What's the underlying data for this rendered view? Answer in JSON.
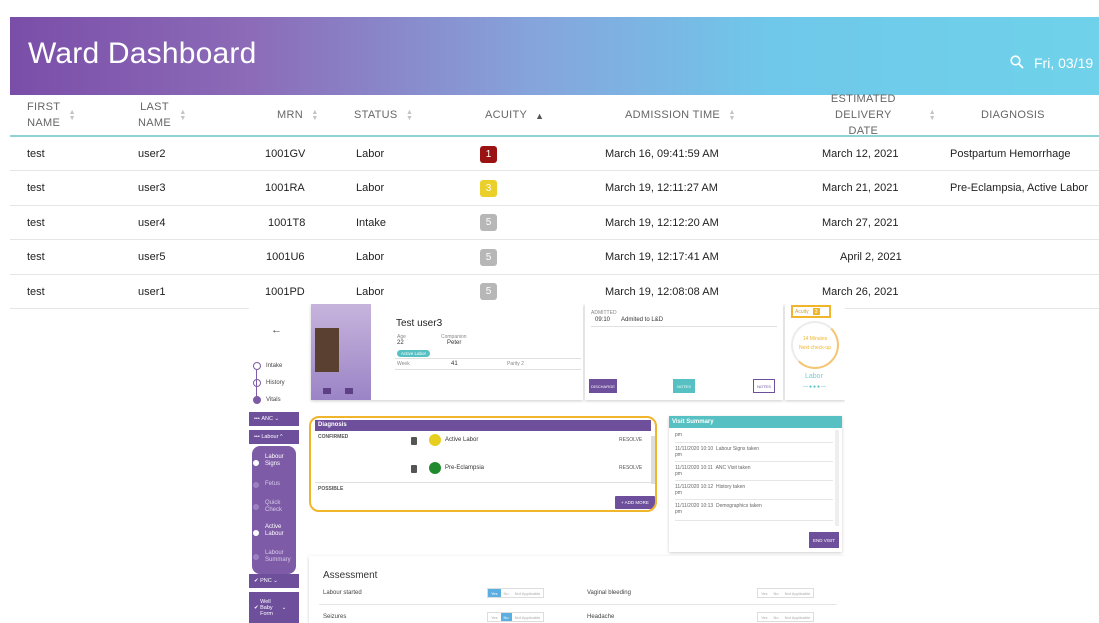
{
  "header": {
    "title": "Ward Dashboard",
    "date": "Fri, 03/19",
    "search_icon": "search-icon",
    "colors": {
      "gradient_start": "#7a4ea8",
      "gradient_end": "#6fd2ea"
    }
  },
  "table": {
    "columns": [
      {
        "line1": "FIRST",
        "line2": "NAME"
      },
      {
        "line1": "LAST",
        "line2": "NAME"
      },
      {
        "line1": "MRN",
        "line2": ""
      },
      {
        "line1": "STATUS",
        "line2": ""
      },
      {
        "line1": "ACUITY",
        "line2": ""
      },
      {
        "line1": "ADMISSION TIME",
        "line2": ""
      },
      {
        "line1": "ESTIMATED DELIVERY",
        "line2": "DATE"
      },
      {
        "line1": "DIAGNOSIS",
        "line2": ""
      }
    ],
    "sorted_column": "ACUITY",
    "rows": [
      {
        "first": "test",
        "last": "user2",
        "mrn": "1001GV",
        "status": "Labor",
        "acuity": "1",
        "acuity_color": "#9b1212",
        "admission": "March 16, 09:41:59 AM",
        "edd": "March 12, 2021",
        "diagnosis": "Postpartum Hemorrhage"
      },
      {
        "first": "test",
        "last": "user3",
        "mrn": "1001RA",
        "status": "Labor",
        "acuity": "3",
        "acuity_color": "#ebcf2a",
        "admission": "March 19, 12:11:27 AM",
        "edd": "March 21, 2021",
        "diagnosis": "Pre-Eclampsia, Active Labor"
      },
      {
        "first": "test",
        "last": "user4",
        "mrn": "1001T8",
        "status": "Intake",
        "acuity": "5",
        "acuity_color": "#b7b7b7",
        "admission": "March 19, 12:12:20 AM",
        "edd": "March 27, 2021",
        "diagnosis": ""
      },
      {
        "first": "test",
        "last": "user5",
        "mrn": "1001U6",
        "status": "Labor",
        "acuity": "5",
        "acuity_color": "#b7b7b7",
        "admission": "March 19, 12:17:41 AM",
        "edd": "April 2, 2021",
        "diagnosis": ""
      },
      {
        "first": "test",
        "last": "user1",
        "mrn": "1001PD",
        "status": "Labor",
        "acuity": "5",
        "acuity_color": "#b7b7b7",
        "admission": "March 19, 12:08:08 AM",
        "edd": "March 26, 2021",
        "diagnosis": ""
      }
    ]
  },
  "patient": {
    "back_icon": "arrow-left-icon",
    "sidebar": {
      "steps": [
        "Intake",
        "History",
        "Vitals"
      ],
      "anc": "ANC",
      "labour": "Labour",
      "labour_subs": [
        "Labour Signs",
        "Fetus",
        "Quick Check",
        "Active Labour",
        "Labour Summary"
      ],
      "pnc": "PNC",
      "wellbaby": "Well Baby Form"
    },
    "name": "Test user3",
    "age_label": "Age",
    "age": "22",
    "companion_label": "Companion",
    "companion": "Peter",
    "badge": "Active Labor",
    "week_label": "Week",
    "week": "41",
    "parity": "Parity 2",
    "admitted_label": "ADMITTED",
    "admitted_time": "09:10",
    "admitted_text": "Admited to L&D",
    "buttons": {
      "discharge": "DISCHARGE",
      "notes_teal": "NOTES",
      "notes": "NOTES"
    },
    "acuity_label": "Acuity",
    "acuity_value": "3",
    "timer_minutes": "14 Minutes",
    "timer_label": "Next check-up",
    "labor_label": "Labor"
  },
  "diagnosis": {
    "title": "Diagnosis",
    "confirmed_label": "CONFIRMED",
    "possible_label": "POSSIBLE",
    "resolve_label": "RESOLVE",
    "add_more": "+ ADD MORE",
    "items": [
      {
        "name": "Active Labor",
        "color": "#e8cf1f"
      },
      {
        "name": "Pre-Eclampsia",
        "color": "#1f8a2e"
      }
    ]
  },
  "visit_summary": {
    "title": "Visit Summary",
    "entries": [
      {
        "time": "pm",
        "text": ""
      },
      {
        "time": "11/11/2020 10:10",
        "text": "Labour Signs taken",
        "suffix": "pm"
      },
      {
        "time": "11/11/2020 10:11",
        "text": "ANC Visit taken",
        "suffix": "pm"
      },
      {
        "time": "11/11/2020 10:12",
        "text": "History taken",
        "suffix": "pm"
      },
      {
        "time": "11/11/2020 10:13",
        "text": "Demographics taken",
        "suffix": "pm"
      }
    ],
    "end_visit": "END VISIT"
  },
  "assessment": {
    "title": "Assessment",
    "options": [
      "Yes",
      "No",
      "Not Applicable"
    ],
    "questions": [
      {
        "label": "Labour started",
        "selected": "Yes"
      },
      {
        "label": "Vaginal bleeding",
        "selected": ""
      },
      {
        "label": "Seizures",
        "selected": "No"
      },
      {
        "label": "Headache",
        "selected": ""
      }
    ]
  }
}
